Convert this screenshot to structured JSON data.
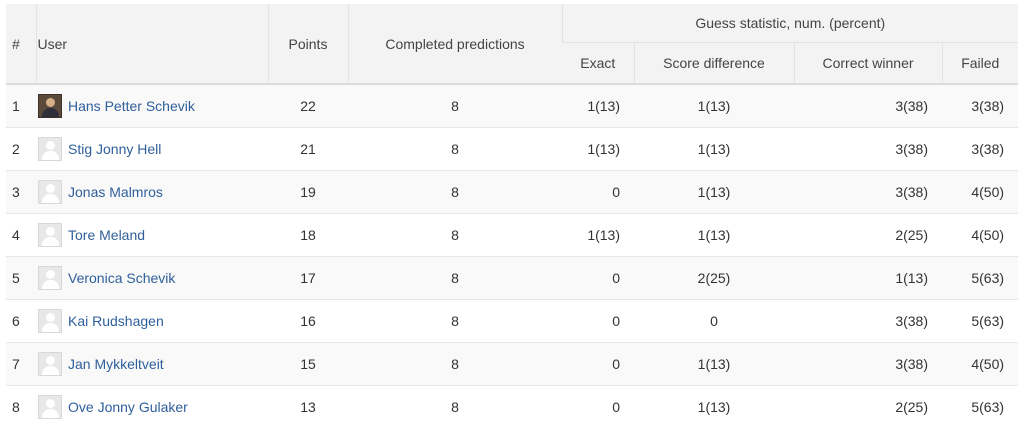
{
  "headers": {
    "rank": "#",
    "user": "User",
    "points": "Points",
    "completed": "Completed predictions",
    "guess_group": "Guess statistic, num. (percent)",
    "exact": "Exact",
    "score_difference": "Score difference",
    "correct_winner": "Correct winner",
    "failed": "Failed"
  },
  "rows": [
    {
      "rank": "1",
      "name": "Hans Petter Schevik",
      "points": "22",
      "completed": "8",
      "exact": "1(13)",
      "score_diff": "1(13)",
      "winner": "3(38)",
      "failed": "3(38)",
      "avatar": "user-photo-icon"
    },
    {
      "rank": "2",
      "name": "Stig Jonny Hell",
      "points": "21",
      "completed": "8",
      "exact": "1(13)",
      "score_diff": "1(13)",
      "winner": "3(38)",
      "failed": "3(38)",
      "avatar": "default-avatar-icon"
    },
    {
      "rank": "3",
      "name": "Jonas Malmros",
      "points": "19",
      "completed": "8",
      "exact": "0",
      "score_diff": "1(13)",
      "winner": "3(38)",
      "failed": "4(50)",
      "avatar": "default-avatar-icon"
    },
    {
      "rank": "4",
      "name": "Tore Meland",
      "points": "18",
      "completed": "8",
      "exact": "1(13)",
      "score_diff": "1(13)",
      "winner": "2(25)",
      "failed": "4(50)",
      "avatar": "default-avatar-icon"
    },
    {
      "rank": "5",
      "name": "Veronica Schevik",
      "points": "17",
      "completed": "8",
      "exact": "0",
      "score_diff": "2(25)",
      "winner": "1(13)",
      "failed": "5(63)",
      "avatar": "default-avatar-icon"
    },
    {
      "rank": "6",
      "name": "Kai Rudshagen",
      "points": "16",
      "completed": "8",
      "exact": "0",
      "score_diff": "0",
      "winner": "3(38)",
      "failed": "5(63)",
      "avatar": "default-avatar-icon"
    },
    {
      "rank": "7",
      "name": "Jan Mykkeltveit",
      "points": "15",
      "completed": "8",
      "exact": "0",
      "score_diff": "1(13)",
      "winner": "3(38)",
      "failed": "4(50)",
      "avatar": "default-avatar-icon"
    },
    {
      "rank": "8",
      "name": "Ove Jonny Gulaker",
      "points": "13",
      "completed": "8",
      "exact": "0",
      "score_diff": "1(13)",
      "winner": "2(25)",
      "failed": "5(63)",
      "avatar": "default-avatar-icon"
    }
  ],
  "colors": {
    "link": "#2f5f9c",
    "header_bg": "#f3f3f3",
    "stripe": "#f9f9f9"
  }
}
